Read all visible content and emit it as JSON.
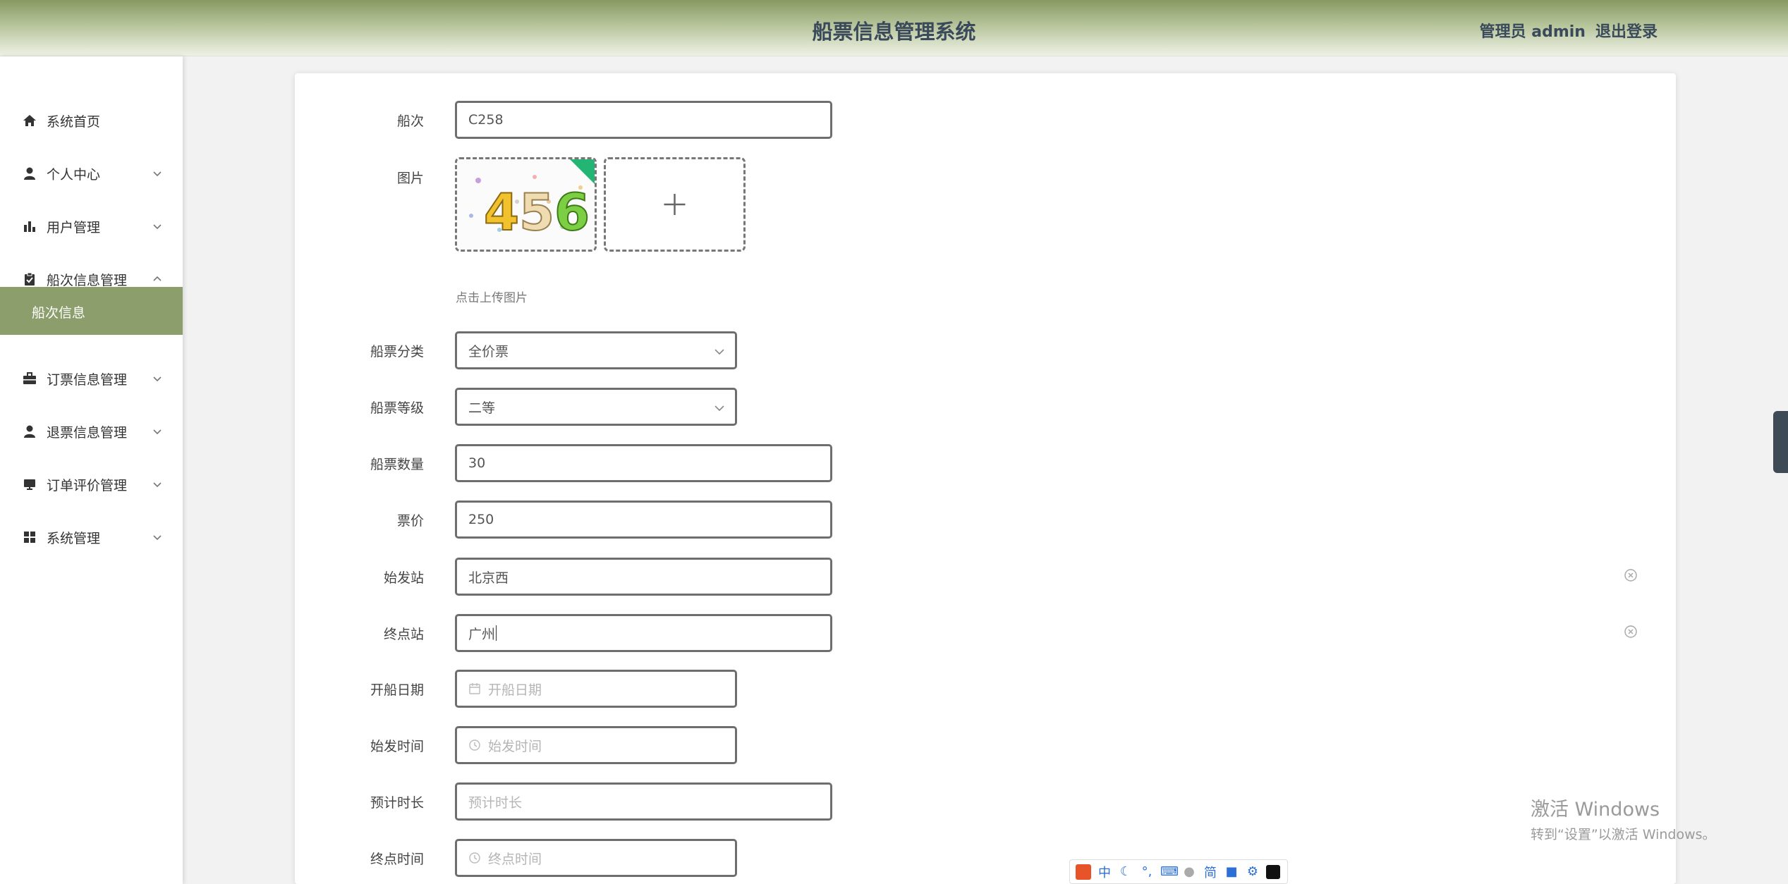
{
  "header": {
    "title": "船票信息管理系统",
    "user": "管理员 admin",
    "logout": "退出登录"
  },
  "sidebar": {
    "items": [
      {
        "label": "系统首页",
        "icon": "home-icon"
      },
      {
        "label": "个人中心",
        "icon": "user-icon"
      },
      {
        "label": "用户管理",
        "icon": "bar-chart-icon"
      },
      {
        "label": "船次信息管理",
        "icon": "clipboard-icon"
      },
      {
        "label": "订票信息管理",
        "icon": "briefcase-icon"
      },
      {
        "label": "退票信息管理",
        "icon": "user-icon"
      },
      {
        "label": "订单评价管理",
        "icon": "monitor-icon"
      },
      {
        "label": "系统管理",
        "icon": "grid-icon"
      }
    ],
    "active_sub": "船次信息"
  },
  "form": {
    "voyage_label": "船次",
    "voyage_value": "C258",
    "image_label": "图片",
    "upload_hint": "点击上传图片",
    "category_label": "船票分类",
    "category_value": "全价票",
    "grade_label": "船票等级",
    "grade_value": "二等",
    "quantity_label": "船票数量",
    "quantity_value": "30",
    "price_label": "票价",
    "price_value": "250",
    "from_label": "始发站",
    "from_value": "北京西",
    "to_label": "终点站",
    "to_value": "广州",
    "date_label": "开船日期",
    "date_placeholder": "开船日期",
    "start_time_label": "始发时间",
    "start_time_placeholder": "始发时间",
    "duration_label": "预计时长",
    "duration_placeholder": "预计时长",
    "end_time_label": "终点时间",
    "end_time_placeholder": "终点时间"
  },
  "thumbnail_digits": [
    "4",
    "5",
    "6"
  ],
  "watermark": {
    "line1": "激活 Windows",
    "line2": "转到“设置”以激活 Windows。"
  },
  "ime": {
    "items": [
      "中",
      "简"
    ]
  },
  "colors": {
    "header": "#879a62",
    "active_menu": "#8c9e6c",
    "title": "#3b4a5a"
  }
}
